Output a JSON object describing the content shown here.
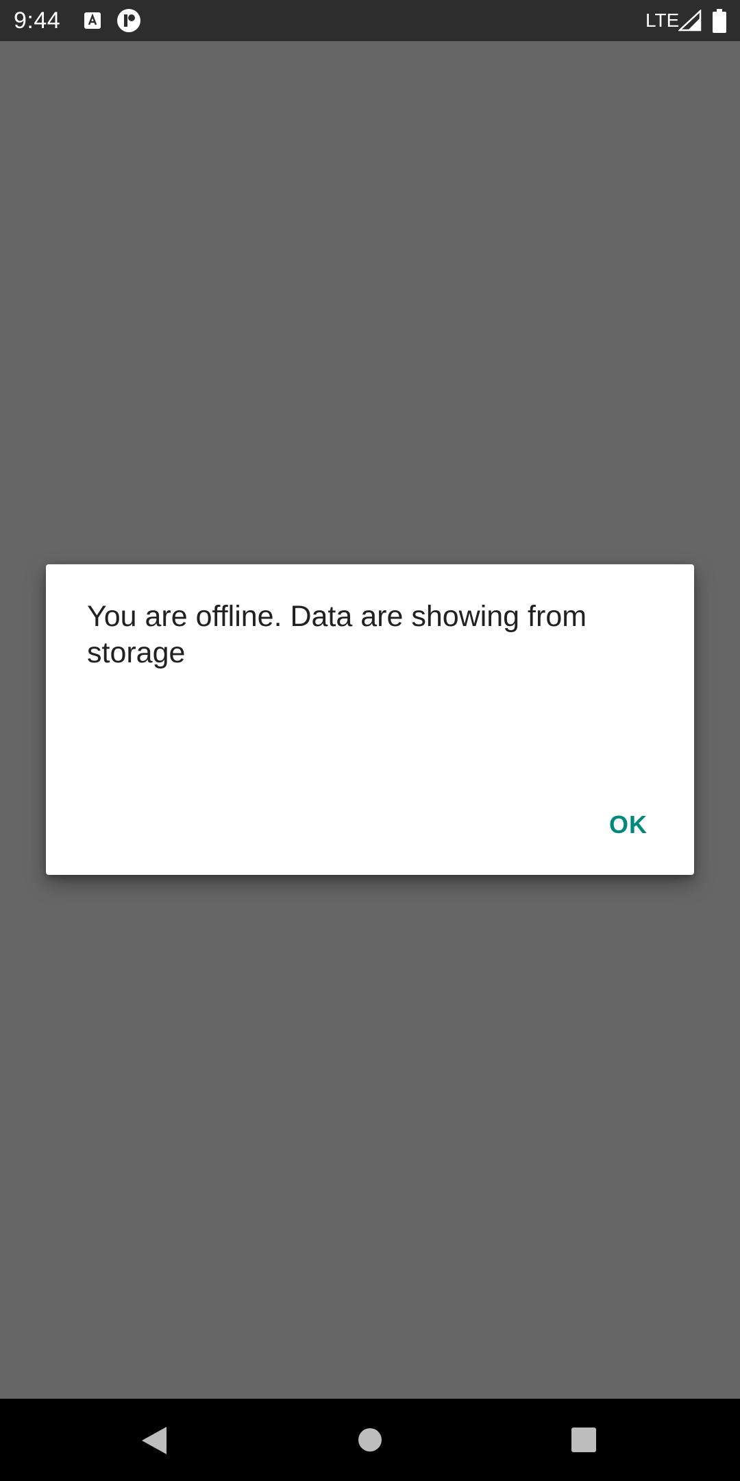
{
  "status_bar": {
    "time": "9:44",
    "network": "LTE",
    "icons": [
      "notification-a-icon",
      "notification-app-icon",
      "signal-icon",
      "battery-icon"
    ]
  },
  "dialog": {
    "message": "You are offline. Data are showing from storage",
    "ok_label": "OK"
  },
  "nav_bar": {
    "icons": [
      "back-icon",
      "home-icon",
      "recents-icon"
    ]
  },
  "colors": {
    "status_bar_bg": "#2d2d2d",
    "scrim": "#666666",
    "dialog_bg": "#ffffff",
    "accent": "#00897b",
    "nav_bar_bg": "#000000"
  }
}
